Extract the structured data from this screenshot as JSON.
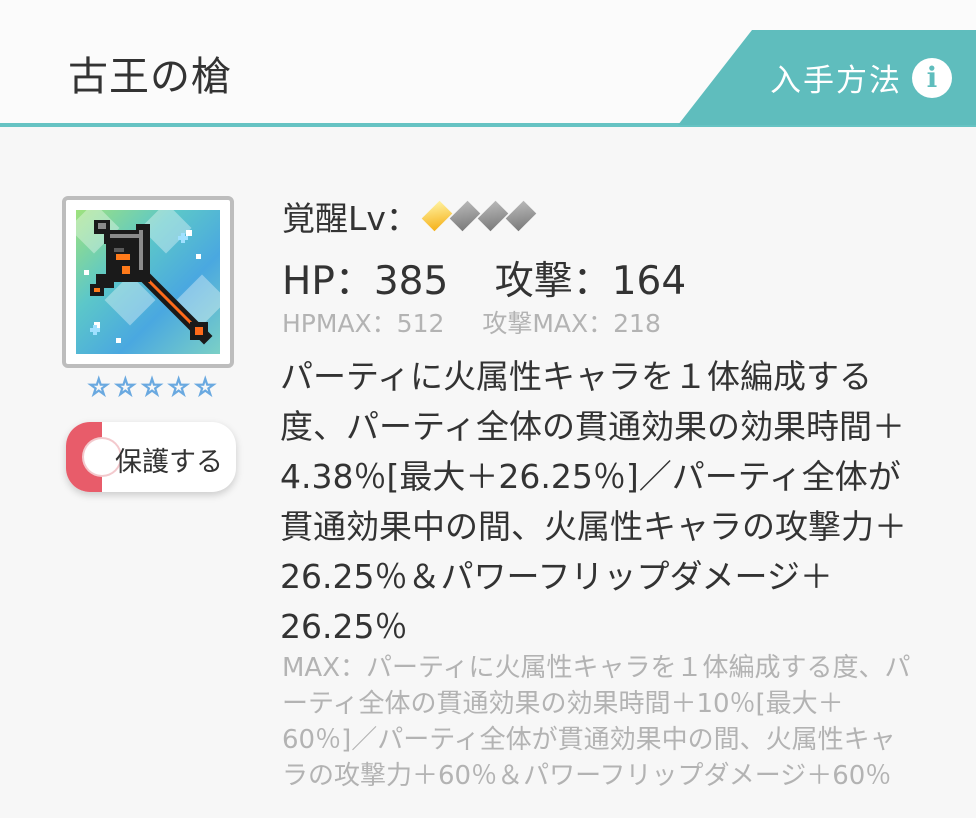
{
  "header": {
    "title": "古王の槍",
    "acquire_label": "入手方法",
    "info_icon": "i"
  },
  "item": {
    "rarity_stars": 5,
    "stars": [
      "☆",
      "☆",
      "☆",
      "☆",
      "☆"
    ],
    "protect_label": "保護する"
  },
  "stats": {
    "awaken_label": "覚醒Lv：",
    "awaken_level": 1,
    "awaken_max": 4,
    "hp": "HP：385",
    "attack": "攻撃：164",
    "hp_max": "HPMAX：512",
    "attack_max": "攻撃MAX：218"
  },
  "description": {
    "text": "パーティに火属性キャラを１体編成する度、パーティ全体の貫通効果の効果時間＋4.38％[最大＋26.25％]／パーティ全体が貫通効果中の間、火属性キャラの攻撃力＋26.25％＆パワーフリップダメージ＋26.25％",
    "max_text": "MAX：パーティに火属性キャラを１体編成する度、パーティ全体の貫通効果の効果時間＋10％[最大＋60％]／パーティ全体が貫通効果中の間、火属性キャラの攻撃力＋60％＆パワーフリップダメージ＋60％"
  },
  "colors": {
    "accent": "#5fbdbd",
    "protect": "#e85c6a",
    "gem_active": "#f5b018",
    "gem_inactive": "#8a8a8a"
  }
}
